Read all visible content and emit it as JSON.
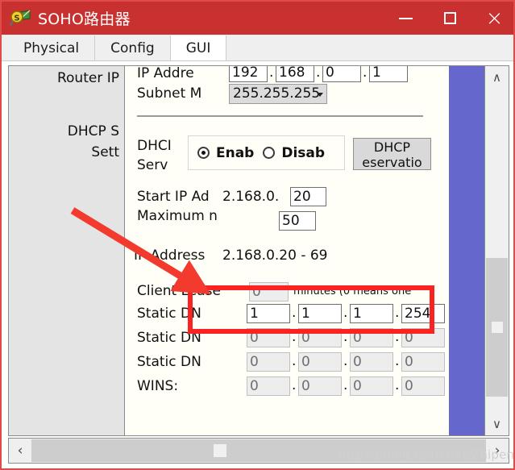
{
  "window": {
    "title": "SOHO路由器",
    "icon": "packet-tracer-icon",
    "minimize_label": "—",
    "maximize_label": "☐",
    "close_label": "×"
  },
  "tabs": [
    {
      "label": "Physical",
      "active": false
    },
    {
      "label": "Config",
      "active": false
    },
    {
      "label": "GUI",
      "active": true
    }
  ],
  "sidebar": {
    "items": [
      {
        "label": "Router IP"
      },
      {
        "label": "DHCP S"
      },
      {
        "label": "Sett"
      }
    ]
  },
  "form": {
    "ip_address": {
      "label": "IP Addre",
      "octets": [
        "192",
        "168",
        "0",
        "1"
      ]
    },
    "subnet_mask": {
      "label": "Subnet M",
      "value": "255.255.255"
    },
    "dhcp_server": {
      "label_line1": "DHCI",
      "label_line2": "Serv",
      "enable_label": "Enab",
      "disable_label": "Disab",
      "selected": "enable",
      "reservation_button_line1": "DHCP",
      "reservation_button_line2": "eservatio"
    },
    "start_ip": {
      "label": "Start IP Ad",
      "prefix": "2.168.0.",
      "value": "20"
    },
    "maximum_users": {
      "label": "Maximum n",
      "value": "50"
    },
    "ip_range": {
      "label": "IP Address",
      "value": "2.168.0.20 - 69"
    },
    "client_lease": {
      "label": "Client Lease",
      "value": "0",
      "note": "minutes (0 means one"
    },
    "static_dns1": {
      "label": "Static DN",
      "octets": [
        "1",
        "1",
        "1",
        "254"
      ]
    },
    "static_dns2": {
      "label": "Static DN",
      "octets": [
        "0",
        "0",
        "0",
        "0"
      ]
    },
    "static_dns3": {
      "label": "Static DN",
      "octets": [
        "0",
        "0",
        "0",
        "0"
      ]
    },
    "wins": {
      "label": "WINS:",
      "octets": [
        "0",
        "0",
        "0",
        "0"
      ]
    }
  },
  "scrollbars": {
    "vertical": {
      "up_glyph": "∧",
      "down_glyph": "∨"
    },
    "horizontal": {
      "left_glyph": "‹",
      "right_glyph": "›"
    }
  },
  "watermark": {
    "text": "https://blog.csdn.net/ZhipenYe"
  },
  "colors": {
    "titlebar": "#c8312f",
    "annotation": "#fb2222",
    "selection_band": "#6667cc",
    "content_bg": "#fffff8"
  }
}
